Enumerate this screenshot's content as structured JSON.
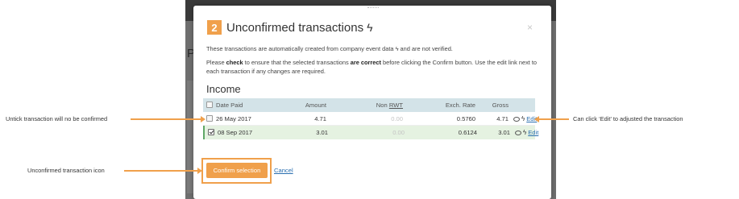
{
  "modal": {
    "step_number": "2",
    "title": "Unconfirmed transactions",
    "close_glyph": "×",
    "description_line1": "These transactions are automatically created from company event data ϟ and are not verified.",
    "description_line2_a": "Please ",
    "description_line2_check": "check",
    "description_line2_b": " to ensure that the selected transactions ",
    "description_line2_correct": "are correct",
    "description_line2_c": " before clicking the Confirm button. Use the edit link next to each transaction if any changes are required.",
    "section_title": "Income",
    "icons": {
      "title": "lightning-bolt-icon",
      "row": "lightning-bolt-icon",
      "comment": "comment-icon"
    }
  },
  "table": {
    "headers": {
      "date": "Date Paid",
      "amount": "Amount",
      "non": "Non ",
      "rwt": "RWT",
      "exch": "Exch. Rate",
      "gross": "Gross"
    },
    "rows": [
      {
        "date": "26 May 2017",
        "amount": "4.71",
        "rwt": "0.00",
        "exch": "0.5760",
        "gross": "4.71",
        "edit": "Edit",
        "checked": false
      },
      {
        "date": "08 Sep 2017",
        "amount": "3.01",
        "rwt": "0.00",
        "exch": "0.6124",
        "gross": "3.01",
        "edit": "Edit",
        "checked": true
      }
    ]
  },
  "buttons": {
    "confirm": "Confirm selection",
    "cancel": "Cancel"
  },
  "annotations": {
    "untick": "Untick transaction will no be confirmed",
    "edit": "Can click ‘Edit’ to adjusted the transaction",
    "icon": "Unconfirmed transaction icon"
  },
  "colors": {
    "accent": "#f0a04b",
    "header_row": "#d3e3e8",
    "selected_row": "#e5f2e1",
    "link": "#2a6fb0"
  }
}
